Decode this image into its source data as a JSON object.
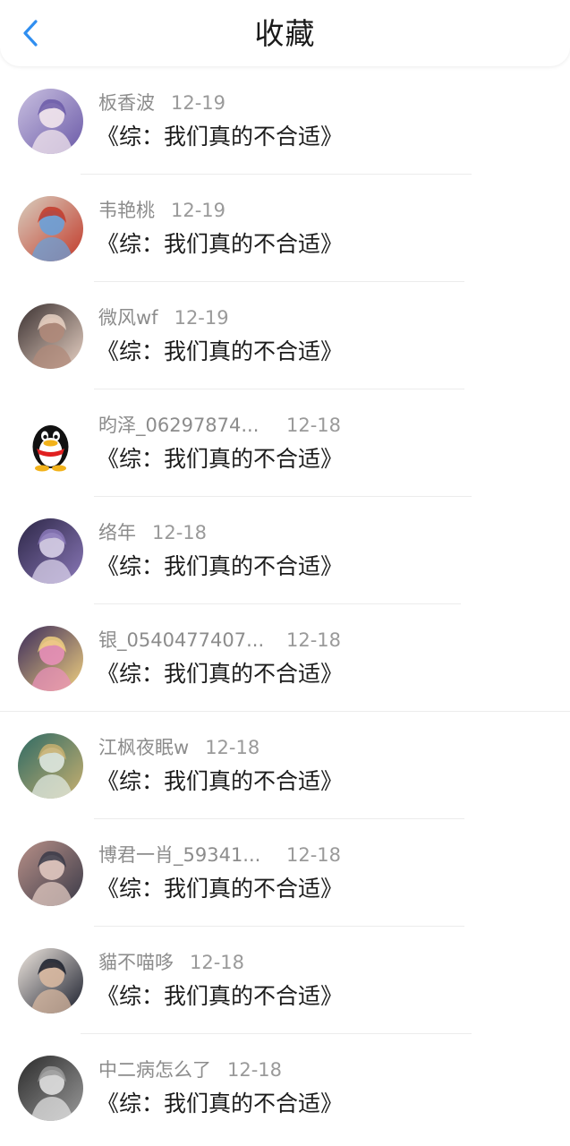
{
  "header": {
    "title": "收藏",
    "back_icon": "chevron-left-icon",
    "back_color": "#2f8ef0"
  },
  "items": [
    {
      "username": "板香波",
      "date": "12-19",
      "content": "《综：我们真的不合适》",
      "avatar": "anime-girl-avatar",
      "colors": [
        "#c9c0e0",
        "#6b5aa8",
        "#f2e6ec"
      ]
    },
    {
      "username": "韦艳桃",
      "date": "12-19",
      "content": "《综：我们真的不合适》",
      "avatar": "anime-shrine-avatar",
      "colors": [
        "#d8cfc0",
        "#c23a2a",
        "#6aa0d8"
      ]
    },
    {
      "username": "微风wf",
      "date": "12-19",
      "content": "《综：我们真的不合适》",
      "avatar": "person-avatar",
      "colors": [
        "#3a3030",
        "#e8d2c4",
        "#b08a7a"
      ]
    },
    {
      "username": "昀泽_06297874...",
      "date": "12-18",
      "content": "《综：我们真的不合适》",
      "avatar": "qq-penguin-avatar",
      "colors": [
        "#ffffff",
        "#111111",
        "#e02020"
      ]
    },
    {
      "username": "络年",
      "date": "12-18",
      "content": "《综：我们真的不合适》",
      "avatar": "anime-dark-avatar",
      "colors": [
        "#2c2646",
        "#8a78b8",
        "#d8d0e8"
      ]
    },
    {
      "username": "银_0540477407...",
      "date": "12-18",
      "content": "《综：我们真的不合适》",
      "avatar": "anime-blonde-avatar",
      "colors": [
        "#3a2a5a",
        "#f0d080",
        "#e890b8"
      ]
    },
    {
      "username": "江枫夜眠w",
      "date": "12-18",
      "content": "《综：我们真的不合适》",
      "avatar": "art-teal-avatar",
      "colors": [
        "#2e6a64",
        "#c8b070",
        "#dfe8e0"
      ]
    },
    {
      "username": "博君一肖_59341...",
      "date": "12-18",
      "content": "《综：我们真的不合适》",
      "avatar": "phone-photo-avatar",
      "colors": [
        "#b89088",
        "#3a3a48",
        "#e0c8c0"
      ]
    },
    {
      "username": "貓不喵哆",
      "date": "12-18",
      "content": "《综：我们真的不合适》",
      "avatar": "cap-person-avatar",
      "colors": [
        "#f0e8e0",
        "#1a1e2c",
        "#d8b8a0"
      ]
    },
    {
      "username": "中二病怎么了",
      "date": "12-18",
      "content": "《综：我们真的不合适》",
      "avatar": "bw-portrait-avatar",
      "colors": [
        "#2a2a2a",
        "#9a9a9a",
        "#e0e0e0"
      ]
    }
  ]
}
